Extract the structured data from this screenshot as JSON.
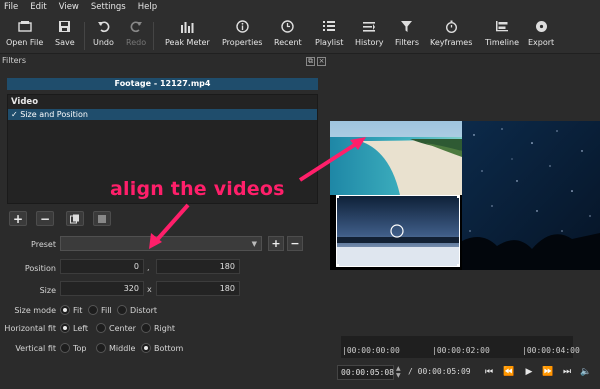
{
  "menu": [
    "File",
    "Edit",
    "View",
    "Settings",
    "Help"
  ],
  "toolbar": {
    "open_file": "Open File",
    "save": "Save",
    "undo": "Undo",
    "redo": "Redo",
    "peak_meter": "Peak Meter",
    "properties": "Properties",
    "recent": "Recent",
    "playlist": "Playlist",
    "history": "History",
    "filters": "Filters",
    "keyframes": "Keyframes",
    "timeline": "Timeline",
    "export": "Export"
  },
  "filters_panel": {
    "title": "Filters",
    "clip_name": "Footage - 12127.mp4",
    "section": "Video",
    "item_check": "✓",
    "item": "Size and Position"
  },
  "params": {
    "preset_label": "Preset",
    "preset_value": "",
    "position_label": "Position",
    "pos_x": "0",
    "pos_sep": ",",
    "pos_y": "180",
    "size_label": "Size",
    "size_w": "320",
    "size_sep": "x",
    "size_h": "180",
    "size_mode_label": "Size mode",
    "size_mode_options": [
      "Fit",
      "Fill",
      "Distort"
    ],
    "size_mode_selected": "Fit",
    "hfit_label": "Horizontal fit",
    "hfit_options": [
      "Left",
      "Center",
      "Right"
    ],
    "hfit_selected": "Left",
    "vfit_label": "Vertical fit",
    "vfit_options": [
      "Top",
      "Middle",
      "Bottom"
    ],
    "vfit_selected": "Bottom"
  },
  "annotation": "align the videos",
  "timeline": {
    "ticks": [
      "|00:00:00:00",
      "|00:00:02:00",
      "|00:00:04:00"
    ]
  },
  "transport": {
    "current": "00:00:05:08",
    "total": "/ 00:00:05:09"
  },
  "colors": {
    "accent": "#1f4d6c",
    "annotation": "#ff1f6a"
  }
}
